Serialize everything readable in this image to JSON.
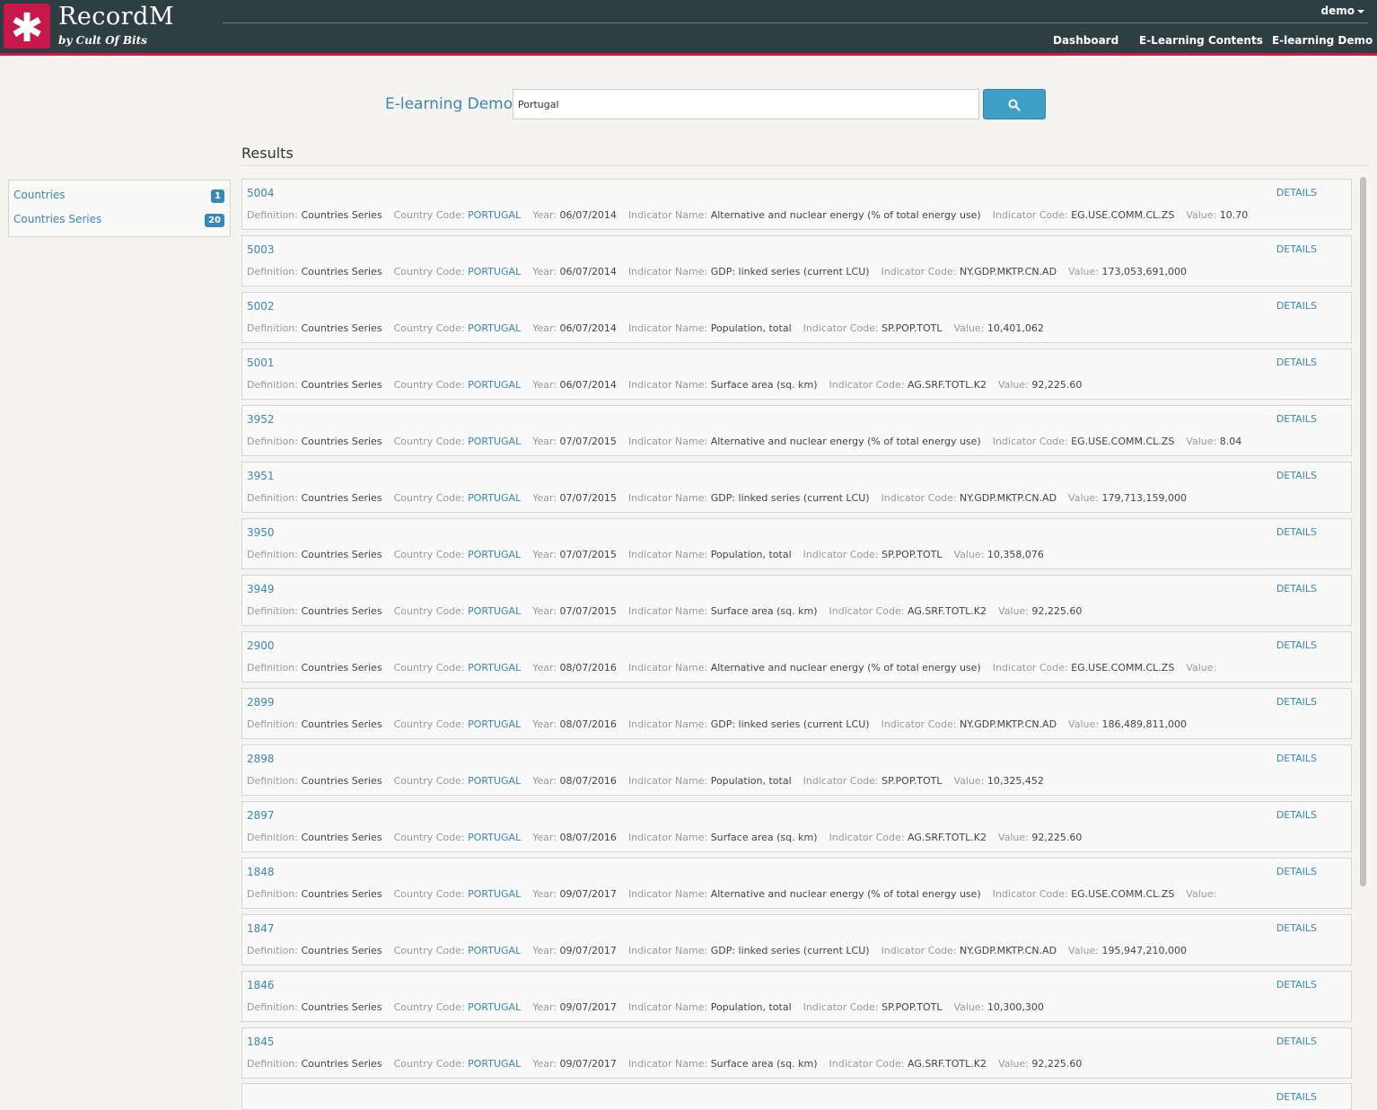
{
  "header": {
    "brand_title": "RecordM",
    "brand_subtitle": "by Cult Of Bits",
    "logo_glyph": "✱",
    "user": "demo",
    "nav": [
      "Dashboard",
      "E-Learning Contents",
      "E-learning Demo"
    ]
  },
  "search": {
    "label": "E-learning Demo",
    "value": "Portugal"
  },
  "results_title": "Results",
  "facets": [
    {
      "label": "Countries",
      "count": "1"
    },
    {
      "label": "Countries Series",
      "count": "20"
    }
  ],
  "field_labels": {
    "definition": "Definition:",
    "country_code": "Country Code:",
    "year": "Year:",
    "indicator_name": "Indicator Name:",
    "indicator_code": "Indicator Code:",
    "value": "Value:"
  },
  "details_label": "DETAILS",
  "records": [
    {
      "id": "5004",
      "definition": "Countries Series",
      "country_code": "PORTUGAL",
      "year": "06/07/2014",
      "indicator_name": "Alternative and nuclear energy (% of total energy use)",
      "indicator_code": "EG.USE.COMM.CL.ZS",
      "value": "10.70"
    },
    {
      "id": "5003",
      "definition": "Countries Series",
      "country_code": "PORTUGAL",
      "year": "06/07/2014",
      "indicator_name": "GDP: linked series (current LCU)",
      "indicator_code": "NY.GDP.MKTP.CN.AD",
      "value": "173,053,691,000"
    },
    {
      "id": "5002",
      "definition": "Countries Series",
      "country_code": "PORTUGAL",
      "year": "06/07/2014",
      "indicator_name": "Population, total",
      "indicator_code": "SP.POP.TOTL",
      "value": "10,401,062"
    },
    {
      "id": "5001",
      "definition": "Countries Series",
      "country_code": "PORTUGAL",
      "year": "06/07/2014",
      "indicator_name": "Surface area (sq. km)",
      "indicator_code": "AG.SRF.TOTL.K2",
      "value": "92,225.60"
    },
    {
      "id": "3952",
      "definition": "Countries Series",
      "country_code": "PORTUGAL",
      "year": "07/07/2015",
      "indicator_name": "Alternative and nuclear energy (% of total energy use)",
      "indicator_code": "EG.USE.COMM.CL.ZS",
      "value": "8.04"
    },
    {
      "id": "3951",
      "definition": "Countries Series",
      "country_code": "PORTUGAL",
      "year": "07/07/2015",
      "indicator_name": "GDP: linked series (current LCU)",
      "indicator_code": "NY.GDP.MKTP.CN.AD",
      "value": "179,713,159,000"
    },
    {
      "id": "3950",
      "definition": "Countries Series",
      "country_code": "PORTUGAL",
      "year": "07/07/2015",
      "indicator_name": "Population, total",
      "indicator_code": "SP.POP.TOTL",
      "value": "10,358,076"
    },
    {
      "id": "3949",
      "definition": "Countries Series",
      "country_code": "PORTUGAL",
      "year": "07/07/2015",
      "indicator_name": "Surface area (sq. km)",
      "indicator_code": "AG.SRF.TOTL.K2",
      "value": "92,225.60"
    },
    {
      "id": "2900",
      "definition": "Countries Series",
      "country_code": "PORTUGAL",
      "year": "08/07/2016",
      "indicator_name": "Alternative and nuclear energy (% of total energy use)",
      "indicator_code": "EG.USE.COMM.CL.ZS",
      "value": ""
    },
    {
      "id": "2899",
      "definition": "Countries Series",
      "country_code": "PORTUGAL",
      "year": "08/07/2016",
      "indicator_name": "GDP: linked series (current LCU)",
      "indicator_code": "NY.GDP.MKTP.CN.AD",
      "value": "186,489,811,000"
    },
    {
      "id": "2898",
      "definition": "Countries Series",
      "country_code": "PORTUGAL",
      "year": "08/07/2016",
      "indicator_name": "Population, total",
      "indicator_code": "SP.POP.TOTL",
      "value": "10,325,452"
    },
    {
      "id": "2897",
      "definition": "Countries Series",
      "country_code": "PORTUGAL",
      "year": "08/07/2016",
      "indicator_name": "Surface area (sq. km)",
      "indicator_code": "AG.SRF.TOTL.K2",
      "value": "92,225.60"
    },
    {
      "id": "1848",
      "definition": "Countries Series",
      "country_code": "PORTUGAL",
      "year": "09/07/2017",
      "indicator_name": "Alternative and nuclear energy (% of total energy use)",
      "indicator_code": "EG.USE.COMM.CL.ZS",
      "value": ""
    },
    {
      "id": "1847",
      "definition": "Countries Series",
      "country_code": "PORTUGAL",
      "year": "09/07/2017",
      "indicator_name": "GDP: linked series (current LCU)",
      "indicator_code": "NY.GDP.MKTP.CN.AD",
      "value": "195,947,210,000"
    },
    {
      "id": "1846",
      "definition": "Countries Series",
      "country_code": "PORTUGAL",
      "year": "09/07/2017",
      "indicator_name": "Population, total",
      "indicator_code": "SP.POP.TOTL",
      "value": "10,300,300"
    },
    {
      "id": "1845",
      "definition": "Countries Series",
      "country_code": "PORTUGAL",
      "year": "09/07/2017",
      "indicator_name": "Surface area (sq. km)",
      "indicator_code": "AG.SRF.TOTL.K2",
      "value": "92,225.60"
    }
  ],
  "colors": {
    "header_bg": "#2e3f44",
    "brand_accent": "#c8174a",
    "link": "#3a86b8",
    "search_button": "#3f9fc7"
  }
}
